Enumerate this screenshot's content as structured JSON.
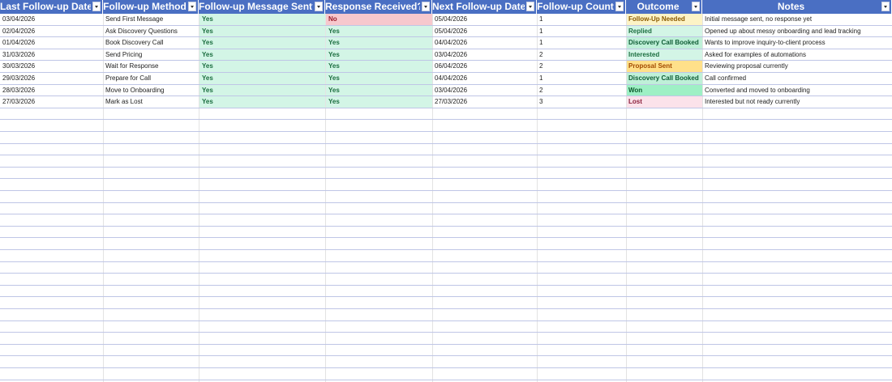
{
  "headers": [
    "Last Follow-up Date",
    "Follow-up Method",
    "Follow-up Message Sent?",
    "Response Received?",
    "Next Follow-up Date",
    "Follow-up Count",
    "Outcome",
    "Notes"
  ],
  "rows": [
    {
      "last": "03/04/2026",
      "method": "Send First Message",
      "sent": "Yes",
      "received": "No",
      "next": "05/04/2026",
      "count": "1",
      "outcome": "Follow-Up Needed",
      "notes": "Initial message sent, no response yet"
    },
    {
      "last": "02/04/2026",
      "method": "Ask Discovery Questions",
      "sent": "Yes",
      "received": "Yes",
      "next": "05/04/2026",
      "count": "1",
      "outcome": "Replied",
      "notes": "Opened up about messy onboarding and lead tracking"
    },
    {
      "last": "01/04/2026",
      "method": "Book Discovery Call",
      "sent": "Yes",
      "received": "Yes",
      "next": "04/04/2026",
      "count": "1",
      "outcome": "Discovery Call Booked",
      "notes": "Wants to improve inquiry-to-client process"
    },
    {
      "last": "31/03/2026",
      "method": "Send Pricing",
      "sent": "Yes",
      "received": "Yes",
      "next": "03/04/2026",
      "count": "2",
      "outcome": "Interested",
      "notes": "Asked for examples of automations"
    },
    {
      "last": "30/03/2026",
      "method": "Wait for Response",
      "sent": "Yes",
      "received": "Yes",
      "next": "06/04/2026",
      "count": "2",
      "outcome": "Proposal Sent",
      "notes": "Reviewing proposal currently"
    },
    {
      "last": "29/03/2026",
      "method": "Prepare for Call",
      "sent": "Yes",
      "received": "Yes",
      "next": "04/04/2026",
      "count": "1",
      "outcome": "Discovery Call Booked",
      "notes": "Call confirmed"
    },
    {
      "last": "28/03/2026",
      "method": "Move to Onboarding",
      "sent": "Yes",
      "received": "Yes",
      "next": "03/04/2026",
      "count": "2",
      "outcome": "Won",
      "notes": "Converted and moved to onboarding"
    },
    {
      "last": "27/03/2026",
      "method": "Mark as Lost",
      "sent": "Yes",
      "received": "Yes",
      "next": "27/03/2026",
      "count": "3",
      "outcome": "Lost",
      "notes": "Interested but not ready currently"
    }
  ],
  "outcome_colors": {
    "Follow-Up Needed": {
      "bg": "#fdf3c6",
      "fg": "#8a5a00"
    },
    "Replied": {
      "bg": "#d3f5e6",
      "fg": "#1b6e3f"
    },
    "Discovery Call Booked": {
      "bg": "#bff0d8",
      "fg": "#0f5c35"
    },
    "Interested": {
      "bg": "#d3f5e6",
      "fg": "#1b6e3f"
    },
    "Proposal Sent": {
      "bg": "#ffe08a",
      "fg": "#a14a00"
    },
    "Won": {
      "bg": "#9ef0c5",
      "fg": "#0c5a2c"
    },
    "Lost": {
      "bg": "#fbe2ea",
      "fg": "#8a1f3b"
    }
  }
}
